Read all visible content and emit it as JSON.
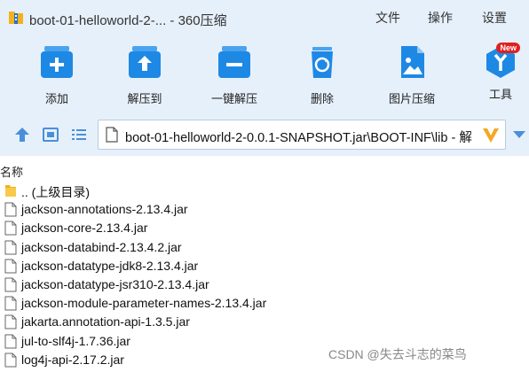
{
  "window": {
    "title": "boot-01-helloworld-2-... - 360压缩"
  },
  "menu": {
    "file": "文件",
    "ops": "操作",
    "settings": "设置"
  },
  "toolbar": {
    "items": [
      {
        "label": "添加",
        "icon": "add-icon"
      },
      {
        "label": "解压到",
        "icon": "extract-to-icon"
      },
      {
        "label": "一键解压",
        "icon": "one-click-extract-icon"
      },
      {
        "label": "删除",
        "icon": "recycle-bin-icon"
      },
      {
        "label": "图片压缩",
        "icon": "image-compress-icon"
      },
      {
        "label": "工具",
        "icon": "tools-icon",
        "badge": "New"
      }
    ]
  },
  "nav": {
    "path": "boot-01-helloworld-2-0.0.1-SNAPSHOT.jar\\BOOT-INF\\lib - 解"
  },
  "columns": {
    "name": "名称"
  },
  "files": [
    {
      "name": ".. (上级目录)",
      "type": "folder"
    },
    {
      "name": "jackson-annotations-2.13.4.jar",
      "type": "file"
    },
    {
      "name": "jackson-core-2.13.4.jar",
      "type": "file"
    },
    {
      "name": "jackson-databind-2.13.4.2.jar",
      "type": "file"
    },
    {
      "name": "jackson-datatype-jdk8-2.13.4.jar",
      "type": "file"
    },
    {
      "name": "jackson-datatype-jsr310-2.13.4.jar",
      "type": "file"
    },
    {
      "name": "jackson-module-parameter-names-2.13.4.jar",
      "type": "file"
    },
    {
      "name": "jakarta.annotation-api-1.3.5.jar",
      "type": "file"
    },
    {
      "name": "jul-to-slf4j-1.7.36.jar",
      "type": "file"
    },
    {
      "name": "log4j-api-2.17.2.jar",
      "type": "file"
    }
  ],
  "watermark": "CSDN @失去斗志的菜鸟",
  "colors": {
    "accent": "#1e88e5",
    "bar_bg": "#e6f0fa",
    "badge": "#e02020"
  }
}
